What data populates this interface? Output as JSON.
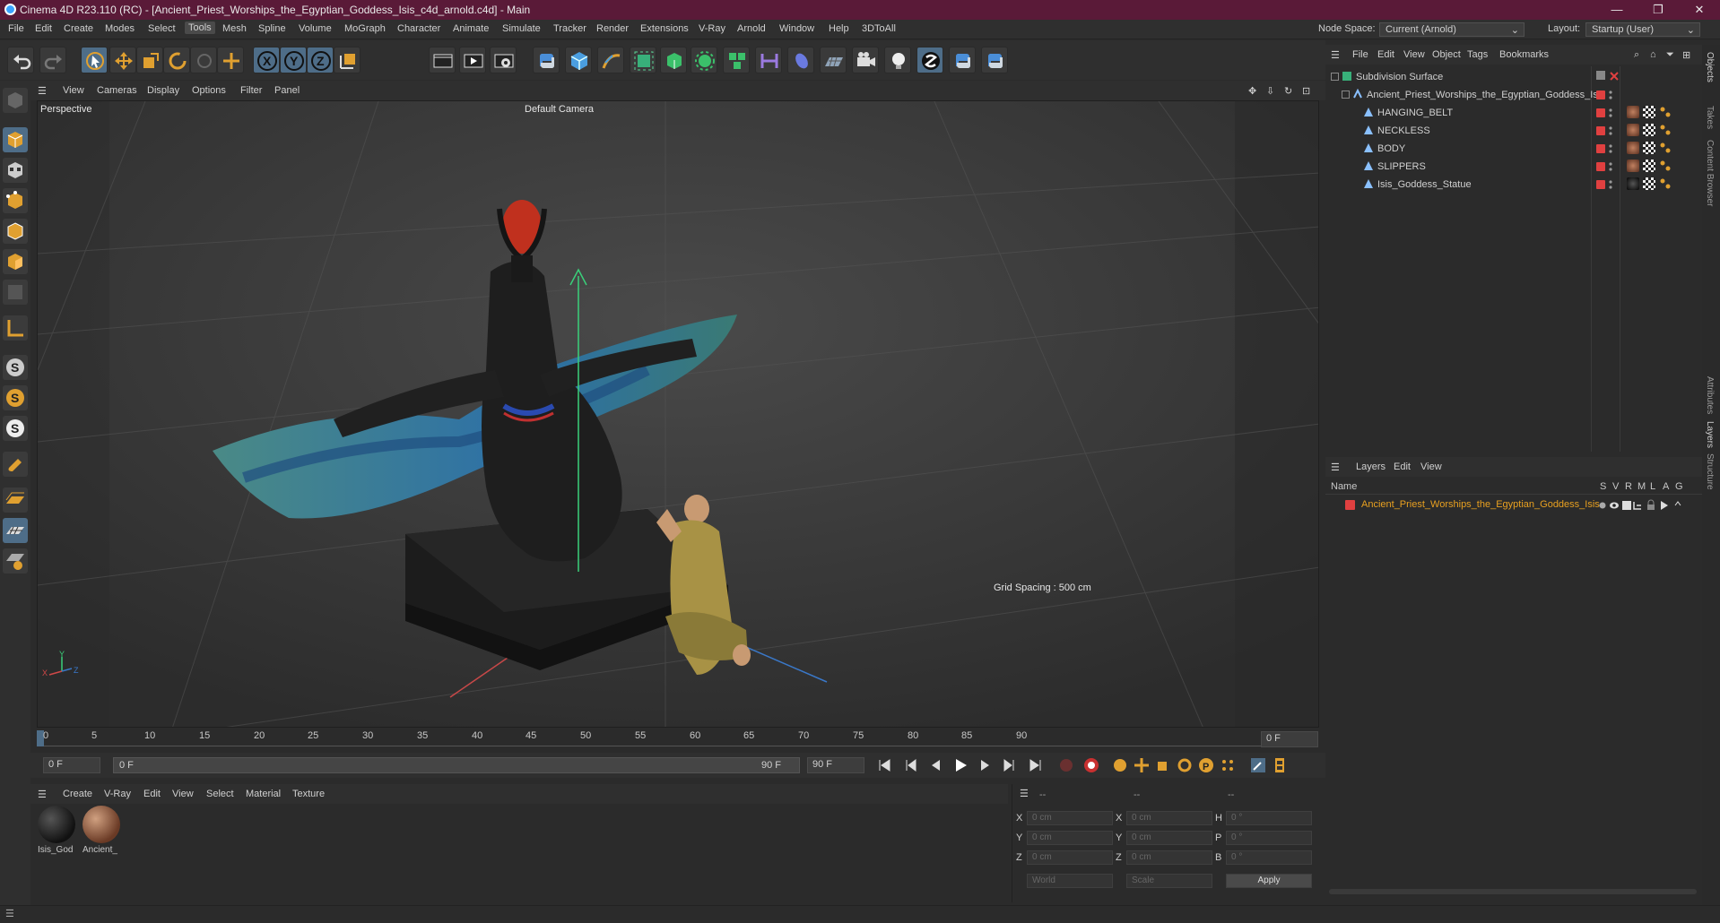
{
  "window": {
    "title": "Cinema 4D R23.110 (RC) - [Ancient_Priest_Worships_the_Egyptian_Goddess_Isis_c4d_arnold.c4d] - Main",
    "minimize": "—",
    "maximize": "❐",
    "close": "✕"
  },
  "menubar": {
    "items": [
      "File",
      "Edit",
      "Create",
      "Modes",
      "Select",
      "Tools",
      "Mesh",
      "Spline",
      "Volume",
      "MoGraph",
      "Character",
      "Animate",
      "Simulate",
      "Tracker",
      "Render",
      "Extensions",
      "V-Ray",
      "Arnold",
      "Window",
      "Help",
      "3DToAll"
    ],
    "active": "Tools",
    "node_space_label": "Node Space:",
    "node_space_value": "Current (Arnold)",
    "layout_label": "Layout:",
    "layout_value": "Startup (User)"
  },
  "viewport": {
    "menu": [
      "View",
      "Cameras",
      "Display",
      "Options",
      "Filter",
      "Panel"
    ],
    "name": "Perspective",
    "camera": "Default Camera",
    "grid_spacing": "Grid Spacing : 500 cm",
    "axis_x": "X",
    "axis_y": "Y",
    "axis_z": "Z"
  },
  "timeline": {
    "ticks": [
      "0",
      "5",
      "10",
      "15",
      "20",
      "25",
      "30",
      "35",
      "40",
      "45",
      "50",
      "55",
      "60",
      "65",
      "70",
      "75",
      "80",
      "85",
      "90"
    ],
    "current_frame": "0 F",
    "start_frame": "0 F",
    "range_start": "0 F",
    "range_end": "90 F",
    "end_frame": "90 F"
  },
  "material_manager": {
    "menu": [
      "Create",
      "V-Ray",
      "Edit",
      "View",
      "Select",
      "Material",
      "Texture"
    ],
    "materials": [
      {
        "name": "Isis_God",
        "color": "#1e1e1e"
      },
      {
        "name": "Ancient_",
        "color": "#8a5a40"
      }
    ]
  },
  "coordinates": {
    "header": [
      "--",
      "--",
      "--"
    ],
    "rows": [
      {
        "a": "X",
        "av": "0 cm",
        "b": "X",
        "bv": "0 cm",
        "c": "H",
        "cv": "0 °"
      },
      {
        "a": "Y",
        "av": "0 cm",
        "b": "Y",
        "bv": "0 cm",
        "c": "P",
        "cv": "0 °"
      },
      {
        "a": "Z",
        "av": "0 cm",
        "b": "Z",
        "bv": "0 cm",
        "c": "B",
        "cv": "0 °"
      }
    ],
    "mode": "World",
    "transform": "Scale",
    "apply": "Apply"
  },
  "object_manager": {
    "menu": [
      "File",
      "Edit",
      "View",
      "Object",
      "Tags",
      "Bookmarks"
    ],
    "objects": [
      {
        "name": "Subdivision Surface"
      },
      {
        "name": "Ancient_Priest_Worships_the_Egyptian_Goddess_Isis"
      },
      {
        "name": "HANGING_BELT"
      },
      {
        "name": "NECKLESS"
      },
      {
        "name": "BODY"
      },
      {
        "name": "SLIPPERS"
      },
      {
        "name": "Isis_Goddess_Statue"
      }
    ]
  },
  "layers": {
    "menu": [
      "Layers",
      "Edit",
      "View"
    ],
    "header_name": "Name",
    "columns": [
      "S",
      "V",
      "R",
      "M",
      "L",
      "A",
      "G"
    ],
    "items": [
      {
        "name": "Ancient_Priest_Worships_the_Egyptian_Goddess_Isis",
        "color": "#e04040"
      }
    ]
  },
  "side_tabs": [
    "Objects",
    "Takes",
    "Content Browser",
    "Attributes",
    "Layers",
    "Structure"
  ],
  "colors": {
    "accent": "#4e6d88",
    "titlebar": "#5a1a38",
    "layer_text": "#e8a020"
  }
}
